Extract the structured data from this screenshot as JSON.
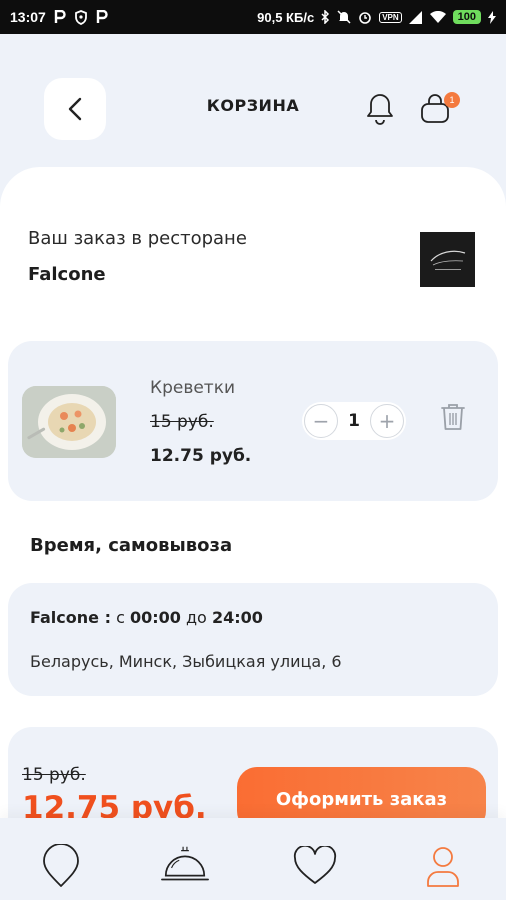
{
  "status_bar": {
    "time": "13:07",
    "network_speed": "90,5 КБ/с",
    "battery": "100",
    "vpn": "VPN"
  },
  "header": {
    "title": "КОРЗИНА",
    "cart_badge": "1",
    "icons": [
      "back-arrow-icon",
      "bell-icon",
      "shopping-bag-icon"
    ]
  },
  "order": {
    "label": "Ваш заказ в ресторане",
    "restaurant": "Falcone"
  },
  "cart_item": {
    "name": "Креветки",
    "old_price": "15 руб.",
    "price": "12.75 руб.",
    "quantity": "1",
    "minus": "−",
    "plus": "+"
  },
  "pickup": {
    "title": "Время, самовывоза",
    "restaurant": "Falcone :",
    "from_word": "с",
    "open_time": "00:00",
    "to_word": "до",
    "close_time": "24:00",
    "address": "Беларусь, Минск, Зыбицкая улица, 6"
  },
  "total": {
    "old_price": "15 руб.",
    "price": "12.75 руб.",
    "checkout_label": "Оформить заказ"
  },
  "tab_bar": {
    "items": [
      "map-pin-icon",
      "cloche-icon",
      "heart-icon",
      "profile-icon"
    ],
    "active": "profile-icon"
  },
  "colors": {
    "accent": "#f47a3f",
    "price_red": "#f0501e",
    "card_bg": "#eef2f9"
  }
}
